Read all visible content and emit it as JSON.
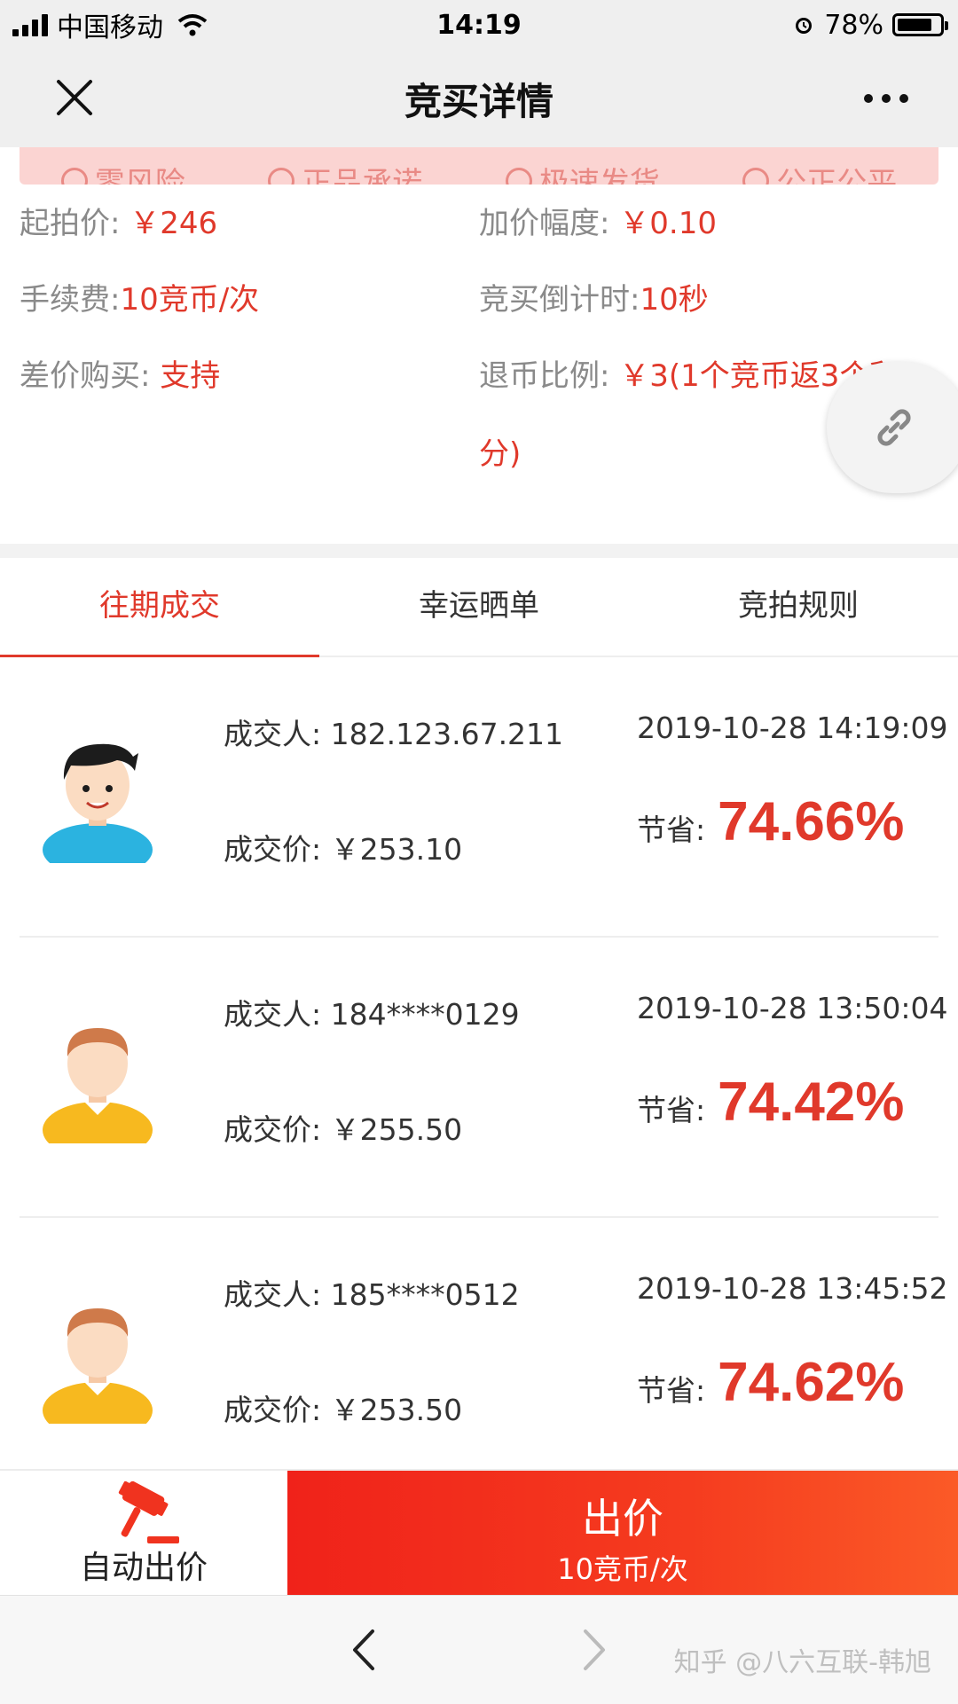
{
  "status_bar": {
    "carrier": "中国移动",
    "time": "14:19",
    "battery": "78%"
  },
  "nav": {
    "title": "竞买详情"
  },
  "promises": [
    "零风险",
    "正品承诺",
    "极速发货",
    "公正公平"
  ],
  "info": {
    "start_price_label": "起拍价:",
    "start_price": "￥246",
    "increment_label": "加价幅度:",
    "increment": "￥0.10",
    "fee_label": "手续费:",
    "fee": "10竞币/次",
    "countdown_label": "竞买倒计时:",
    "countdown": "10秒",
    "diff_buy_label": "差价购买:",
    "diff_buy": "支持",
    "refund_label": "退币比例:",
    "refund_line1": "￥3(1个竞币返3个积",
    "refund_line2": "分)"
  },
  "tabs": [
    "往期成交",
    "幸运晒单",
    "竞拍规则"
  ],
  "records": [
    {
      "buyer_label": "成交人:",
      "buyer": "182.123.67.211",
      "time": "2019-10-28 14:19:09",
      "price_label": "成交价:",
      "price": "￥253.10",
      "save_label": "节省:",
      "save": "74.66%",
      "avatar": "boy-blue-shirt"
    },
    {
      "buyer_label": "成交人:",
      "buyer": "184****0129",
      "time": "2019-10-28 13:50:04",
      "price_label": "成交价:",
      "price": "￥255.50",
      "save_label": "节省:",
      "save": "74.42%",
      "avatar": "boy-yellow-shirt"
    },
    {
      "buyer_label": "成交人:",
      "buyer": "185****0512",
      "time": "2019-10-28 13:45:52",
      "price_label": "成交价:",
      "price": "￥253.50",
      "save_label": "节省:",
      "save": "74.62%",
      "avatar": "boy-yellow-shirt"
    }
  ],
  "action": {
    "auto_bid": "自动出价",
    "bid": "出价",
    "bid_cost": "10竞币/次"
  },
  "watermark": "知乎 @八六互联-韩旭",
  "colors": {
    "accent": "#e0392b",
    "promise_bg": "#fbd4d2"
  }
}
